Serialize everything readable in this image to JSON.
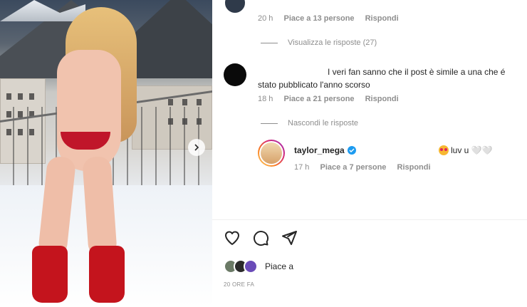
{
  "colors": {
    "verified": "#1d9bf0",
    "muted": "#8e8e8e",
    "text": "#262626"
  },
  "media": {
    "next_icon": "chevron-right-icon"
  },
  "top_comment_meta": {
    "time": "20 h",
    "likes": "Piace a 13 persone",
    "reply": "Rispondi"
  },
  "view_replies": "Visualizza le risposte (27)",
  "comment": {
    "text": "I veri fan sanno che il post è simile a una che é stato pubblicato l'anno scorso",
    "time": "18 h",
    "likes": "Piace a 21 persone",
    "reply": "Rispondi"
  },
  "hide_replies": "Nascondi le risposte",
  "reply": {
    "username": "taylor_mega",
    "verified_icon": "verified-badge-icon",
    "text": "luv u 🤍🤍",
    "time": "17 h",
    "likes": "Piace a 7 persone",
    "reply": "Rispondi"
  },
  "actions": {
    "like_icon": "heart-icon",
    "comment_icon": "comment-icon",
    "share_icon": "share-icon"
  },
  "likes_summary": "Piace a",
  "post_time": "20 ORE FA"
}
